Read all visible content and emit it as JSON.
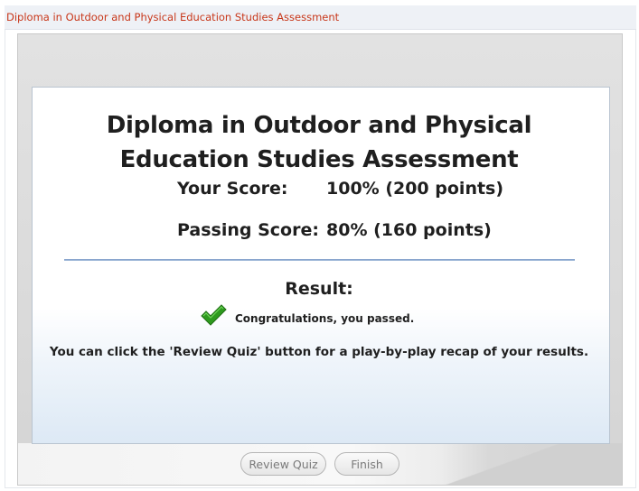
{
  "window": {
    "title": "Diploma in Outdoor and Physical Education Studies Assessment"
  },
  "results": {
    "heading_line1": "Diploma in Outdoor and Physical",
    "heading_line2": "Education Studies Assessment",
    "your_score_label": "Your Score:",
    "your_score_value": "100% (200 points)",
    "passing_score_label": "Passing Score:",
    "passing_score_value": "80% (160 points)",
    "result_label": "Result:",
    "result_icon": "checkmark-icon",
    "result_message": "Congratulations, you passed.",
    "review_note": "You can click the 'Review Quiz' button for a play-by-play recap of your results."
  },
  "buttons": {
    "review_label": "Review Quiz",
    "finish_label": "Finish"
  },
  "colors": {
    "title_text": "#c8371a",
    "check_green": "#2e9a1e",
    "divider": "#7f9ec9"
  }
}
